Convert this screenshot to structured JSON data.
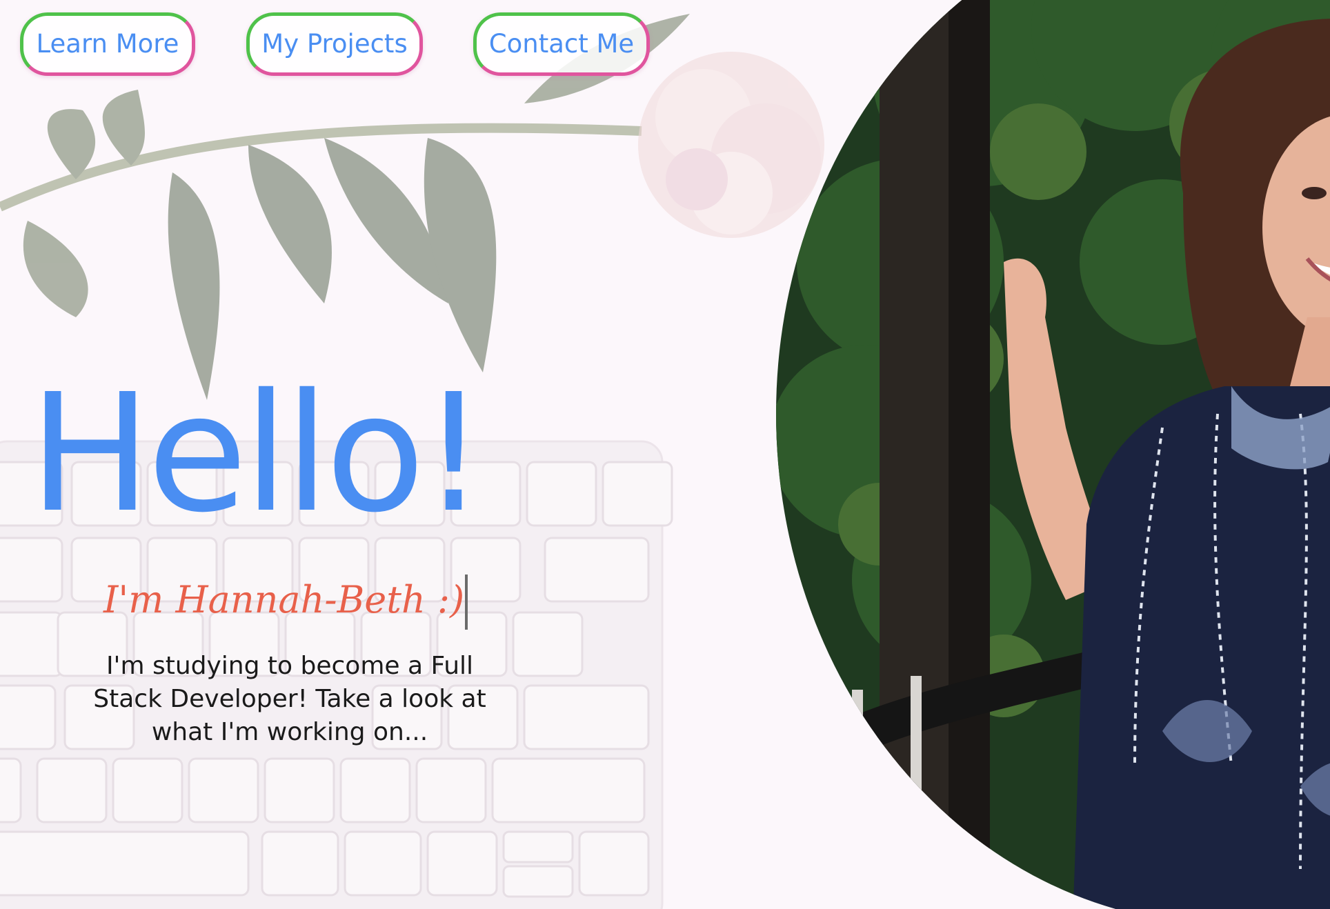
{
  "nav": {
    "learn_more": "Learn More",
    "my_projects": "My Projects",
    "contact_me": "Contact Me"
  },
  "hero": {
    "title": "Hello!",
    "name": "I'm Hannah-Beth :)",
    "description": "I'm studying to become a Full Stack Developer! Take a look at what I'm working on..."
  },
  "colors": {
    "accent_blue": "#4a8ef2",
    "name_coral": "#e8604a",
    "border_green": "#4fc24a",
    "border_pink": "#e0559e"
  }
}
